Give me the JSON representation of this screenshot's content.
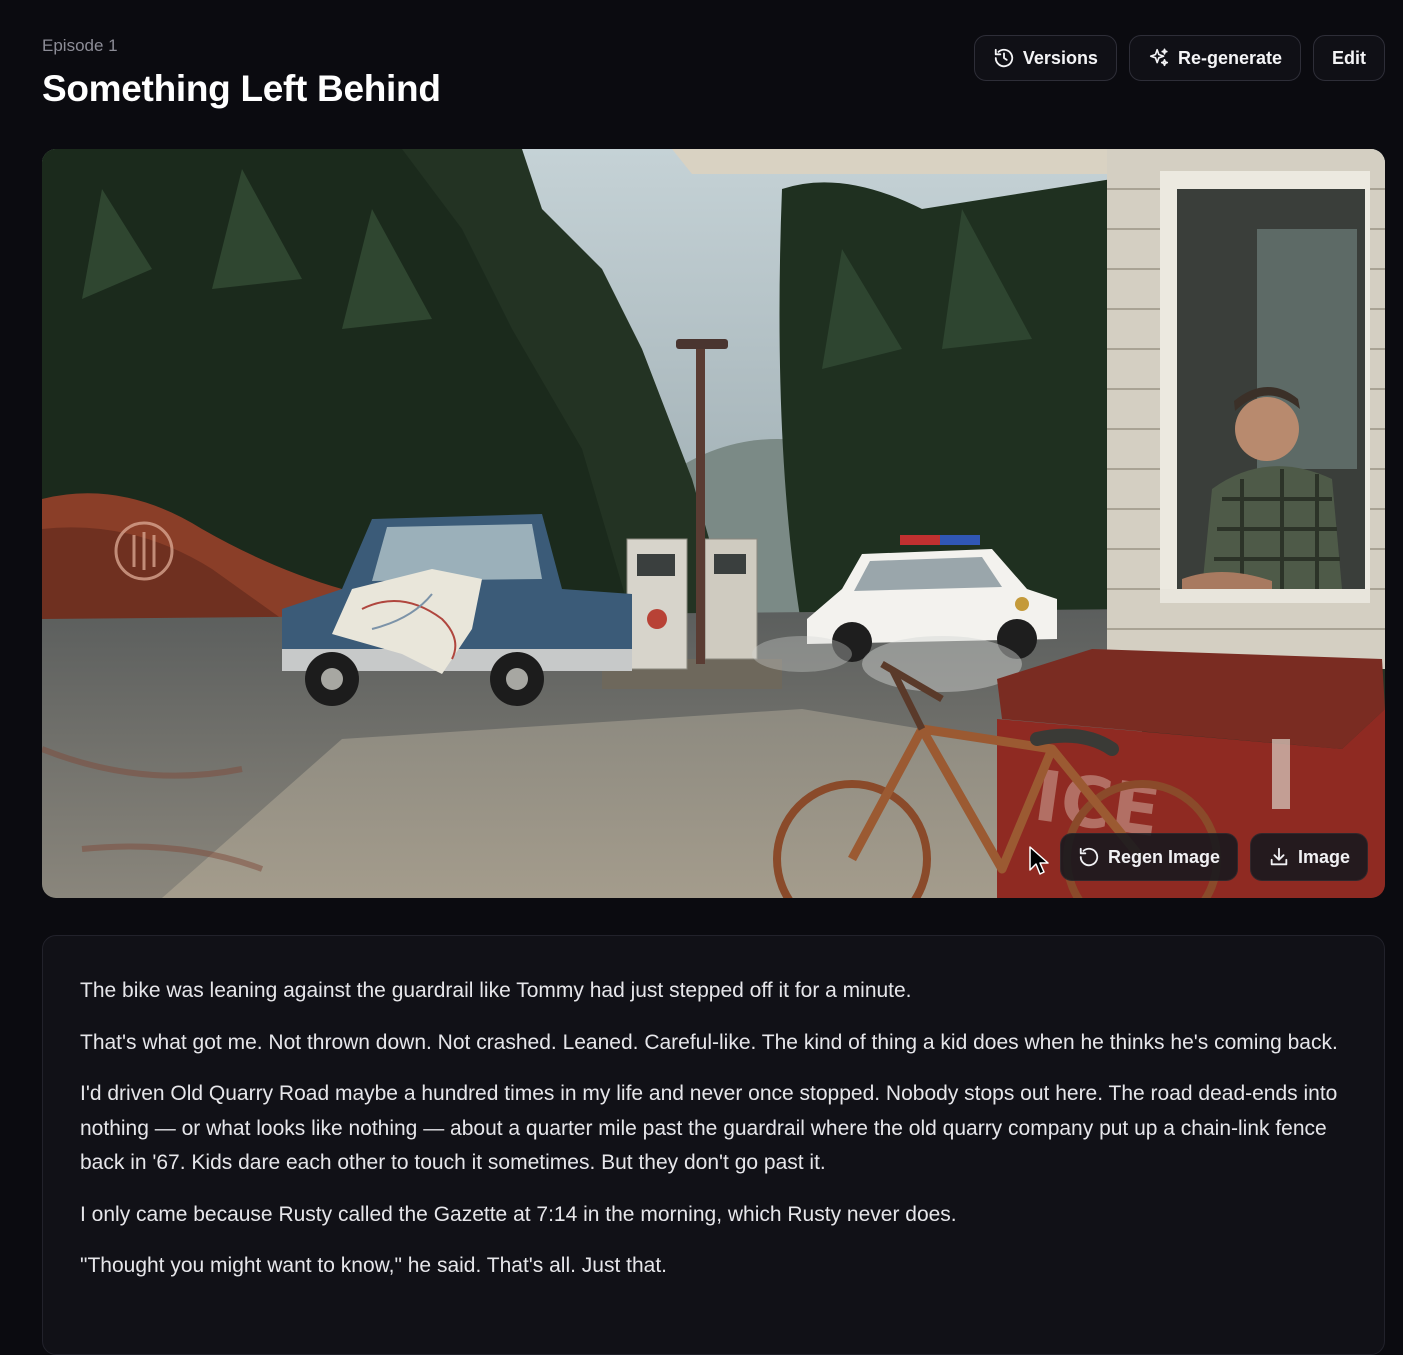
{
  "episode": {
    "label": "Episode 1",
    "title": "Something Left Behind"
  },
  "toolbar": {
    "versions_label": "Versions",
    "versions_icon": "history-icon",
    "regenerate_label": "Re-generate",
    "regenerate_icon": "sparkles-icon",
    "edit_label": "Edit"
  },
  "image": {
    "alt": "Rural gas station with blue pickup truck, police car, rusty bicycle, ice chest and a man leaning out of a window",
    "sign_text": "ICE",
    "regen_label": "Regen Image",
    "regen_icon": "rotate-ccw-icon",
    "download_label": "Image",
    "download_icon": "download-icon"
  },
  "story": {
    "paragraphs": [
      "The bike was leaning against the guardrail like Tommy had just stepped off it for a minute.",
      "That's what got me. Not thrown down. Not crashed. Leaned. Careful-like. The kind of thing a kid does when he thinks he's coming back.",
      "I'd driven Old Quarry Road maybe a hundred times in my life and never once stopped. Nobody stops out here. The road dead-ends into nothing — or what looks like nothing — about a quarter mile past the guardrail where the old quarry company put up a chain-link fence back in '67. Kids dare each other to touch it sometimes. But they don't go past it.",
      "I only came because Rusty called the Gazette at 7:14 in the morning, which Rusty never does.",
      "\"Thought you might want to know,\" he said. That's all. Just that."
    ]
  },
  "colors": {
    "background": "#0b0b10",
    "card": "#111117",
    "border": "#2e2e38",
    "text": "#e6e6ea",
    "muted": "#8c8c96"
  }
}
